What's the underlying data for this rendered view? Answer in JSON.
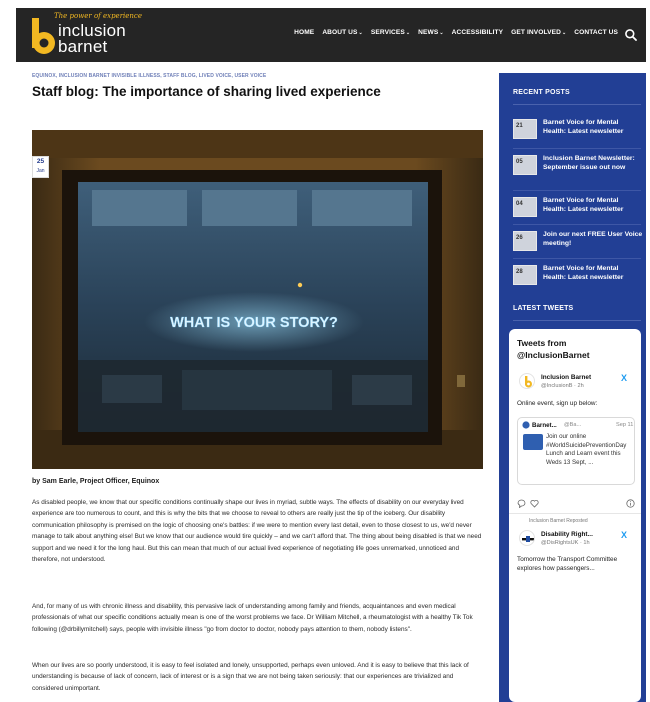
{
  "header": {
    "logo_tagline": "The power of experience",
    "logo_line1": "inclusion",
    "logo_line2": "barnet",
    "nav": [
      {
        "label": "HOME",
        "caret": false
      },
      {
        "label": "ABOUT US",
        "caret": true
      },
      {
        "label": "SERVICES",
        "caret": true
      },
      {
        "label": "NEWS",
        "caret": true
      },
      {
        "label": "ACCESSIBILITY",
        "caret": false
      },
      {
        "label": "GET INVOLVED",
        "caret": true
      },
      {
        "label": "CONTACT US",
        "caret": false
      }
    ],
    "search_icon": "search-icon"
  },
  "article": {
    "breadcrumb": "EQUINOX, INCLUSION BARNET INVISIBLE ILLNESS, STAFF BLOG, LIVED VOICE, USER VOICE",
    "title": "Staff blog: The importance of sharing lived experience",
    "date_day": "25",
    "date_month": "Jan",
    "hero_neon_text": "WHAT IS YOUR STORY?",
    "byline": "by Sam Earle, Project Officer, Equinox",
    "paragraphs": [
      "As disabled people,  we know that our specific conditions continually shape our lives in myriad, subtle ways. The effects of disability on our everyday lived experience are too numerous to count, and this is why the bits that we choose to reveal to others are really just the tip of the iceberg. Our disability communication philosophy is premised on the logic of choosing one's battles: if we were to mention every last detail, even to those closest to us, we'd never manage to talk about anything else! But we know that our audience would tire quickly – and we can't afford that. The thing about being disabled is that we need support and we need it for the long haul. But this can mean that much of our actual lived experience of negotiating life goes unremarked, unnoticed and therefore, not understood.",
      "And, for many of us with chronic illness and disability, this pervasive lack of understanding among family and friends, acquaintances and even medical professionals of what our specific conditions actually mean is one of the worst problems we face. Dr William Mitchell, a rheumatologist with a healthy Tik Tok following (@drbillymitchell) says, people with invisible illness \"go from doctor to doctor, nobody pays attention to them, nobody listens\".",
      "When our lives are so poorly understood, it is easy to feel isolated and lonely, unsupported, perhaps even unloved. And it is easy to believe that this lack of understanding is because of lack of concern, lack of interest or is a sign that we are not being taken seriously: that our experiences are trivialized and considered unimportant."
    ]
  },
  "sidebar": {
    "recent_heading": "RECENT POSTS",
    "posts": [
      {
        "day": "21",
        "title": "Barnet Voice for Mental Health: Latest newsletter"
      },
      {
        "day": "05",
        "title": "Inclusion Barnet Newsletter: September issue out now"
      },
      {
        "day": "04",
        "title": "Barnet Voice for Mental Health: Latest newsletter"
      },
      {
        "day": "26",
        "title": "Join our next FREE User Voice meeting!"
      },
      {
        "day": "28",
        "title": "Barnet Voice for Mental Health: Latest newsletter"
      }
    ],
    "tweets_heading": "LATEST TWEETS",
    "tweets": {
      "title": "Tweets from @InclusionBarnet",
      "tweet1_name": "Inclusion Barnet",
      "tweet1_handle": "@InclusionB · 2h",
      "tweet1_text": "Online event, sign up below:",
      "quote_name": "Barnet...",
      "quote_handle": "@Ba...",
      "quote_date": "Sep 11",
      "quote_text": "Join our online #WorldSuicidePreventionDay Lunch and Learn event this Weds 13 Sept, ...",
      "retweet_note": "Inclusion Barnet Reposted",
      "tweet2_name": "Disability Right...",
      "tweet2_handle": "@DisRightsUK · 1h",
      "tweet2_text": "Tomorrow the Transport Committee explores how passengers..."
    }
  },
  "colors": {
    "header_bg": "#252525",
    "sidebar_bg": "#223f95",
    "logo_yellow": "#f2b822",
    "neon_blue": "#8ad4ff",
    "x_blue": "#1d9bf0"
  }
}
